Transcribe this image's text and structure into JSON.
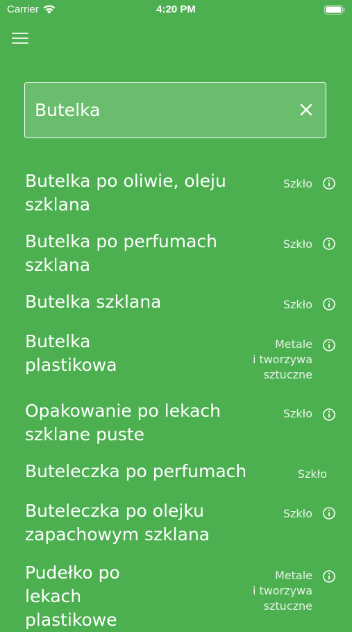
{
  "status_bar": {
    "carrier": "Carrier",
    "time": "4:20 PM"
  },
  "search": {
    "value": "Butelka"
  },
  "results": [
    {
      "name_lines": [
        "Butelka po oliwie, oleju",
        "szklana"
      ],
      "category_lines": [
        "Szkło"
      ],
      "info": true
    },
    {
      "name_lines": [
        "Butelka po perfumach",
        "szklana"
      ],
      "category_lines": [
        "Szkło"
      ],
      "info": true
    },
    {
      "name_lines": [
        "Butelka szklana"
      ],
      "category_lines": [
        "Szkło"
      ],
      "info": true
    },
    {
      "name_lines": [
        "Butelka",
        "plastikowa"
      ],
      "category_lines": [
        "Metale",
        "i tworzywa",
        "sztuczne"
      ],
      "info": true
    },
    {
      "name_lines": [
        "Opakowanie po lekach",
        "szklane puste"
      ],
      "category_lines": [
        "Szkło"
      ],
      "info": true
    },
    {
      "name_lines": [
        "Buteleczka po perfumach"
      ],
      "category_lines": [
        "Szkło"
      ],
      "info": false
    },
    {
      "name_lines": [
        "Buteleczka po olejku",
        "zapachowym szklana"
      ],
      "category_lines": [
        "Szkło"
      ],
      "info": true
    },
    {
      "name_lines": [
        "Pudełko po",
        "lekach",
        "plastikowe"
      ],
      "category_lines": [
        "Metale",
        "i tworzywa",
        "sztuczne"
      ],
      "info": true
    }
  ]
}
